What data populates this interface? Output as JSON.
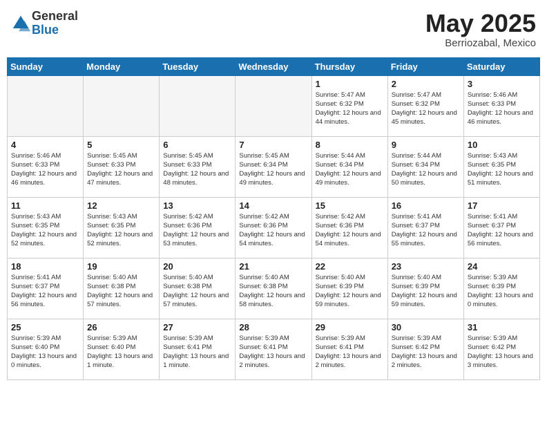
{
  "logo": {
    "general": "General",
    "blue": "Blue"
  },
  "title": {
    "month": "May 2025",
    "location": "Berriozabal, Mexico"
  },
  "weekdays": [
    "Sunday",
    "Monday",
    "Tuesday",
    "Wednesday",
    "Thursday",
    "Friday",
    "Saturday"
  ],
  "weeks": [
    [
      {
        "day": "",
        "info": ""
      },
      {
        "day": "",
        "info": ""
      },
      {
        "day": "",
        "info": ""
      },
      {
        "day": "",
        "info": ""
      },
      {
        "day": "1",
        "info": "Sunrise: 5:47 AM\nSunset: 6:32 PM\nDaylight: 12 hours\nand 44 minutes."
      },
      {
        "day": "2",
        "info": "Sunrise: 5:47 AM\nSunset: 6:32 PM\nDaylight: 12 hours\nand 45 minutes."
      },
      {
        "day": "3",
        "info": "Sunrise: 5:46 AM\nSunset: 6:33 PM\nDaylight: 12 hours\nand 46 minutes."
      }
    ],
    [
      {
        "day": "4",
        "info": "Sunrise: 5:46 AM\nSunset: 6:33 PM\nDaylight: 12 hours\nand 46 minutes."
      },
      {
        "day": "5",
        "info": "Sunrise: 5:45 AM\nSunset: 6:33 PM\nDaylight: 12 hours\nand 47 minutes."
      },
      {
        "day": "6",
        "info": "Sunrise: 5:45 AM\nSunset: 6:33 PM\nDaylight: 12 hours\nand 48 minutes."
      },
      {
        "day": "7",
        "info": "Sunrise: 5:45 AM\nSunset: 6:34 PM\nDaylight: 12 hours\nand 49 minutes."
      },
      {
        "day": "8",
        "info": "Sunrise: 5:44 AM\nSunset: 6:34 PM\nDaylight: 12 hours\nand 49 minutes."
      },
      {
        "day": "9",
        "info": "Sunrise: 5:44 AM\nSunset: 6:34 PM\nDaylight: 12 hours\nand 50 minutes."
      },
      {
        "day": "10",
        "info": "Sunrise: 5:43 AM\nSunset: 6:35 PM\nDaylight: 12 hours\nand 51 minutes."
      }
    ],
    [
      {
        "day": "11",
        "info": "Sunrise: 5:43 AM\nSunset: 6:35 PM\nDaylight: 12 hours\nand 52 minutes."
      },
      {
        "day": "12",
        "info": "Sunrise: 5:43 AM\nSunset: 6:35 PM\nDaylight: 12 hours\nand 52 minutes."
      },
      {
        "day": "13",
        "info": "Sunrise: 5:42 AM\nSunset: 6:36 PM\nDaylight: 12 hours\nand 53 minutes."
      },
      {
        "day": "14",
        "info": "Sunrise: 5:42 AM\nSunset: 6:36 PM\nDaylight: 12 hours\nand 54 minutes."
      },
      {
        "day": "15",
        "info": "Sunrise: 5:42 AM\nSunset: 6:36 PM\nDaylight: 12 hours\nand 54 minutes."
      },
      {
        "day": "16",
        "info": "Sunrise: 5:41 AM\nSunset: 6:37 PM\nDaylight: 12 hours\nand 55 minutes."
      },
      {
        "day": "17",
        "info": "Sunrise: 5:41 AM\nSunset: 6:37 PM\nDaylight: 12 hours\nand 56 minutes."
      }
    ],
    [
      {
        "day": "18",
        "info": "Sunrise: 5:41 AM\nSunset: 6:37 PM\nDaylight: 12 hours\nand 56 minutes."
      },
      {
        "day": "19",
        "info": "Sunrise: 5:40 AM\nSunset: 6:38 PM\nDaylight: 12 hours\nand 57 minutes."
      },
      {
        "day": "20",
        "info": "Sunrise: 5:40 AM\nSunset: 6:38 PM\nDaylight: 12 hours\nand 57 minutes."
      },
      {
        "day": "21",
        "info": "Sunrise: 5:40 AM\nSunset: 6:38 PM\nDaylight: 12 hours\nand 58 minutes."
      },
      {
        "day": "22",
        "info": "Sunrise: 5:40 AM\nSunset: 6:39 PM\nDaylight: 12 hours\nand 59 minutes."
      },
      {
        "day": "23",
        "info": "Sunrise: 5:40 AM\nSunset: 6:39 PM\nDaylight: 12 hours\nand 59 minutes."
      },
      {
        "day": "24",
        "info": "Sunrise: 5:39 AM\nSunset: 6:39 PM\nDaylight: 13 hours\nand 0 minutes."
      }
    ],
    [
      {
        "day": "25",
        "info": "Sunrise: 5:39 AM\nSunset: 6:40 PM\nDaylight: 13 hours\nand 0 minutes."
      },
      {
        "day": "26",
        "info": "Sunrise: 5:39 AM\nSunset: 6:40 PM\nDaylight: 13 hours\nand 1 minute."
      },
      {
        "day": "27",
        "info": "Sunrise: 5:39 AM\nSunset: 6:41 PM\nDaylight: 13 hours\nand 1 minute."
      },
      {
        "day": "28",
        "info": "Sunrise: 5:39 AM\nSunset: 6:41 PM\nDaylight: 13 hours\nand 2 minutes."
      },
      {
        "day": "29",
        "info": "Sunrise: 5:39 AM\nSunset: 6:41 PM\nDaylight: 13 hours\nand 2 minutes."
      },
      {
        "day": "30",
        "info": "Sunrise: 5:39 AM\nSunset: 6:42 PM\nDaylight: 13 hours\nand 2 minutes."
      },
      {
        "day": "31",
        "info": "Sunrise: 5:39 AM\nSunset: 6:42 PM\nDaylight: 13 hours\nand 3 minutes."
      }
    ]
  ]
}
